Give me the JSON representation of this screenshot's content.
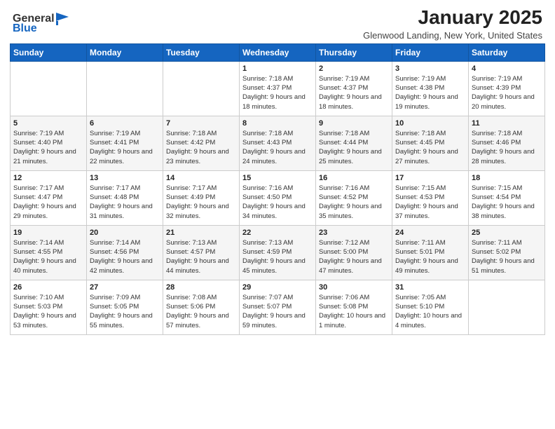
{
  "header": {
    "logo_general": "General",
    "logo_blue": "Blue",
    "month": "January 2025",
    "location": "Glenwood Landing, New York, United States"
  },
  "days_of_week": [
    "Sunday",
    "Monday",
    "Tuesday",
    "Wednesday",
    "Thursday",
    "Friday",
    "Saturday"
  ],
  "weeks": [
    [
      {
        "day": "",
        "sunrise": "",
        "sunset": "",
        "daylight": ""
      },
      {
        "day": "",
        "sunrise": "",
        "sunset": "",
        "daylight": ""
      },
      {
        "day": "",
        "sunrise": "",
        "sunset": "",
        "daylight": ""
      },
      {
        "day": "1",
        "sunrise": "Sunrise: 7:18 AM",
        "sunset": "Sunset: 4:37 PM",
        "daylight": "Daylight: 9 hours and 18 minutes."
      },
      {
        "day": "2",
        "sunrise": "Sunrise: 7:19 AM",
        "sunset": "Sunset: 4:37 PM",
        "daylight": "Daylight: 9 hours and 18 minutes."
      },
      {
        "day": "3",
        "sunrise": "Sunrise: 7:19 AM",
        "sunset": "Sunset: 4:38 PM",
        "daylight": "Daylight: 9 hours and 19 minutes."
      },
      {
        "day": "4",
        "sunrise": "Sunrise: 7:19 AM",
        "sunset": "Sunset: 4:39 PM",
        "daylight": "Daylight: 9 hours and 20 minutes."
      }
    ],
    [
      {
        "day": "5",
        "sunrise": "Sunrise: 7:19 AM",
        "sunset": "Sunset: 4:40 PM",
        "daylight": "Daylight: 9 hours and 21 minutes."
      },
      {
        "day": "6",
        "sunrise": "Sunrise: 7:19 AM",
        "sunset": "Sunset: 4:41 PM",
        "daylight": "Daylight: 9 hours and 22 minutes."
      },
      {
        "day": "7",
        "sunrise": "Sunrise: 7:18 AM",
        "sunset": "Sunset: 4:42 PM",
        "daylight": "Daylight: 9 hours and 23 minutes."
      },
      {
        "day": "8",
        "sunrise": "Sunrise: 7:18 AM",
        "sunset": "Sunset: 4:43 PM",
        "daylight": "Daylight: 9 hours and 24 minutes."
      },
      {
        "day": "9",
        "sunrise": "Sunrise: 7:18 AM",
        "sunset": "Sunset: 4:44 PM",
        "daylight": "Daylight: 9 hours and 25 minutes."
      },
      {
        "day": "10",
        "sunrise": "Sunrise: 7:18 AM",
        "sunset": "Sunset: 4:45 PM",
        "daylight": "Daylight: 9 hours and 27 minutes."
      },
      {
        "day": "11",
        "sunrise": "Sunrise: 7:18 AM",
        "sunset": "Sunset: 4:46 PM",
        "daylight": "Daylight: 9 hours and 28 minutes."
      }
    ],
    [
      {
        "day": "12",
        "sunrise": "Sunrise: 7:17 AM",
        "sunset": "Sunset: 4:47 PM",
        "daylight": "Daylight: 9 hours and 29 minutes."
      },
      {
        "day": "13",
        "sunrise": "Sunrise: 7:17 AM",
        "sunset": "Sunset: 4:48 PM",
        "daylight": "Daylight: 9 hours and 31 minutes."
      },
      {
        "day": "14",
        "sunrise": "Sunrise: 7:17 AM",
        "sunset": "Sunset: 4:49 PM",
        "daylight": "Daylight: 9 hours and 32 minutes."
      },
      {
        "day": "15",
        "sunrise": "Sunrise: 7:16 AM",
        "sunset": "Sunset: 4:50 PM",
        "daylight": "Daylight: 9 hours and 34 minutes."
      },
      {
        "day": "16",
        "sunrise": "Sunrise: 7:16 AM",
        "sunset": "Sunset: 4:52 PM",
        "daylight": "Daylight: 9 hours and 35 minutes."
      },
      {
        "day": "17",
        "sunrise": "Sunrise: 7:15 AM",
        "sunset": "Sunset: 4:53 PM",
        "daylight": "Daylight: 9 hours and 37 minutes."
      },
      {
        "day": "18",
        "sunrise": "Sunrise: 7:15 AM",
        "sunset": "Sunset: 4:54 PM",
        "daylight": "Daylight: 9 hours and 38 minutes."
      }
    ],
    [
      {
        "day": "19",
        "sunrise": "Sunrise: 7:14 AM",
        "sunset": "Sunset: 4:55 PM",
        "daylight": "Daylight: 9 hours and 40 minutes."
      },
      {
        "day": "20",
        "sunrise": "Sunrise: 7:14 AM",
        "sunset": "Sunset: 4:56 PM",
        "daylight": "Daylight: 9 hours and 42 minutes."
      },
      {
        "day": "21",
        "sunrise": "Sunrise: 7:13 AM",
        "sunset": "Sunset: 4:57 PM",
        "daylight": "Daylight: 9 hours and 44 minutes."
      },
      {
        "day": "22",
        "sunrise": "Sunrise: 7:13 AM",
        "sunset": "Sunset: 4:59 PM",
        "daylight": "Daylight: 9 hours and 45 minutes."
      },
      {
        "day": "23",
        "sunrise": "Sunrise: 7:12 AM",
        "sunset": "Sunset: 5:00 PM",
        "daylight": "Daylight: 9 hours and 47 minutes."
      },
      {
        "day": "24",
        "sunrise": "Sunrise: 7:11 AM",
        "sunset": "Sunset: 5:01 PM",
        "daylight": "Daylight: 9 hours and 49 minutes."
      },
      {
        "day": "25",
        "sunrise": "Sunrise: 7:11 AM",
        "sunset": "Sunset: 5:02 PM",
        "daylight": "Daylight: 9 hours and 51 minutes."
      }
    ],
    [
      {
        "day": "26",
        "sunrise": "Sunrise: 7:10 AM",
        "sunset": "Sunset: 5:03 PM",
        "daylight": "Daylight: 9 hours and 53 minutes."
      },
      {
        "day": "27",
        "sunrise": "Sunrise: 7:09 AM",
        "sunset": "Sunset: 5:05 PM",
        "daylight": "Daylight: 9 hours and 55 minutes."
      },
      {
        "day": "28",
        "sunrise": "Sunrise: 7:08 AM",
        "sunset": "Sunset: 5:06 PM",
        "daylight": "Daylight: 9 hours and 57 minutes."
      },
      {
        "day": "29",
        "sunrise": "Sunrise: 7:07 AM",
        "sunset": "Sunset: 5:07 PM",
        "daylight": "Daylight: 9 hours and 59 minutes."
      },
      {
        "day": "30",
        "sunrise": "Sunrise: 7:06 AM",
        "sunset": "Sunset: 5:08 PM",
        "daylight": "Daylight: 10 hours and 1 minute."
      },
      {
        "day": "31",
        "sunrise": "Sunrise: 7:05 AM",
        "sunset": "Sunset: 5:10 PM",
        "daylight": "Daylight: 10 hours and 4 minutes."
      },
      {
        "day": "",
        "sunrise": "",
        "sunset": "",
        "daylight": ""
      }
    ]
  ]
}
